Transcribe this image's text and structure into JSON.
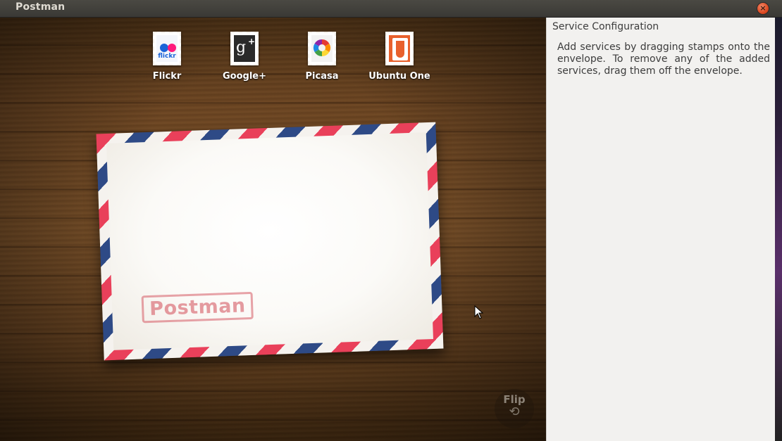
{
  "window": {
    "title": "Postman",
    "close_glyph": "×"
  },
  "stamps": [
    {
      "id": "flickr",
      "label": "Flickr",
      "icon": "flickr-icon",
      "icon_text": "flickr"
    },
    {
      "id": "googleplus",
      "label": "Google+",
      "icon": "google-plus-icon",
      "icon_text": "g",
      "icon_plus": "+"
    },
    {
      "id": "picasa",
      "label": "Picasa",
      "icon": "picasa-icon"
    },
    {
      "id": "ubuntuone",
      "label": "Ubuntu One",
      "icon": "ubuntu-one-icon"
    }
  ],
  "envelope": {
    "postmark": "Postman"
  },
  "flip": {
    "label": "Flip",
    "icon": "⟲"
  },
  "config": {
    "title": "Service Configuration",
    "description": "Add services by dragging stamps onto the envelope. To remove any of the added services, drag them off the envelope."
  },
  "colors": {
    "airmail_red": "#e9405a",
    "airmail_blue": "#2e4a86",
    "close_button": "#df4a22",
    "panel_bg": "#f2f1ef"
  }
}
